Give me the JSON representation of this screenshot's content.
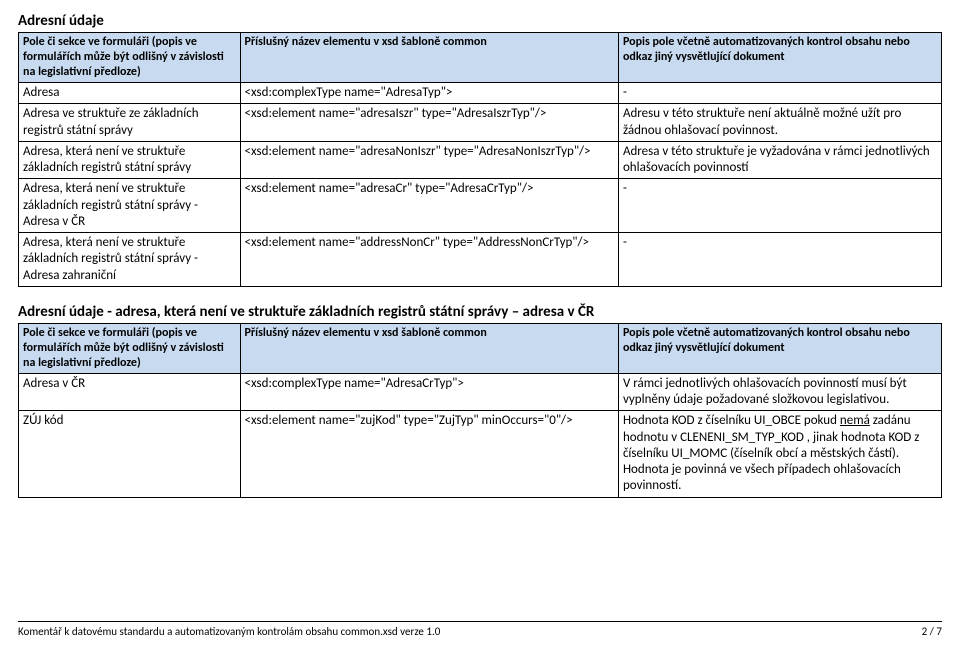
{
  "section1": {
    "title": "Adresní údaje",
    "chart_data": {
      "type": "table",
      "columns": [
        "Pole či sekce ve formuláři (popis ve formulářích může být odlišný v závislosti na legislativní předloze)",
        "Příslušný název elementu v xsd šabloně common",
        "Popis pole včetně automatizovaných kontrol obsahu nebo odkaz jiný vysvětlující dokument"
      ],
      "rows": [
        [
          "Adresa",
          "<xsd:complexType name=\"AdresaTyp\">",
          "-"
        ],
        [
          "Adresa ve struktuře ze základních registrů státní správy",
          "<xsd:element name=\"adresaIszr\" type=\"AdresaIszrTyp\"/>",
          "Adresu v této struktuře není aktuálně možné užít pro žádnou ohlašovací povinnost."
        ],
        [
          "Adresa, která není ve struktuře základních registrů státní správy",
          "<xsd:element name=\"adresaNonIszr\" type=\"AdresaNonIszrTyp\"/>",
          "Adresa v této struktuře je vyžadována v rámci jednotlivých ohlašovacích povinností"
        ],
        [
          "Adresa, která není ve struktuře základních registrů státní správy - Adresa v ČR",
          "<xsd:element name=\"adresaCr\" type=\"AdresaCrTyp\"/>",
          "-"
        ],
        [
          "Adresa, která není ve struktuře základních registrů státní správy - Adresa zahraniční",
          "<xsd:element name=\"addressNonCr\" type=\"AddressNonCrTyp\"/>",
          "-"
        ]
      ]
    }
  },
  "section2": {
    "title": "Adresní údaje - adresa, která není ve struktuře základních registrů státní správy – adresa v ČR",
    "chart_data": {
      "type": "table",
      "columns": [
        "Pole či sekce ve formuláři (popis ve formulářích může být odlišný v závislosti na legislativní předloze)",
        "Příslušný název elementu v xsd šabloně common",
        "Popis pole včetně automatizovaných kontrol obsahu nebo odkaz jiný vysvětlující dokument"
      ],
      "rows": [
        [
          "Adresa v ČR",
          "<xsd:complexType name=\"AdresaCrTyp\">",
          "V rámci jednotlivých ohlašovacích povinností musí být vyplněny údaje požadované složkovou legislativou."
        ],
        [
          "ZÚJ kód",
          "<xsd:element name=\"zujKod\" type=\"ZujTyp\" minOccurs=\"0\"/>",
          {
            "pre": "Hodnota KOD z číselníku UI_OBCE pokud ",
            "u": "nemá",
            "post": " zadánu hodnotu v CLENENI_SM_TYP_KOD , jinak hodnota KOD z číselníku UI_MOMC (číselník obcí a městských částí). Hodnota je povinná ve všech případech ohlašovacích povinností."
          }
        ]
      ]
    }
  },
  "footer": {
    "left": "Komentář k datovému standardu a automatizovaným kontrolám obsahu common.xsd verze 1.0",
    "right": "2 / 7"
  }
}
